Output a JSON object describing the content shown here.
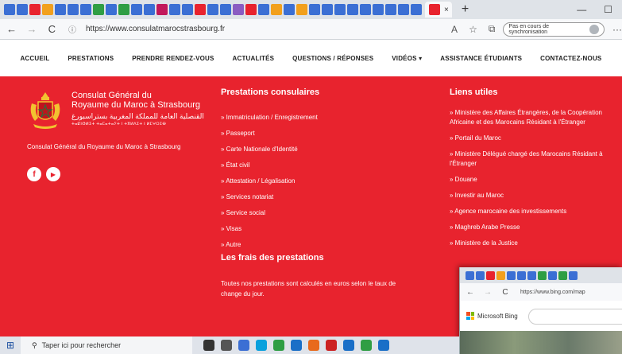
{
  "browser": {
    "tab_close": "×",
    "new_tab": "+",
    "window_controls": [
      "—",
      "☐"
    ],
    "back": "←",
    "forward": "→",
    "refresh": "C",
    "url": "https://www.consulatmarocstrasbourg.fr",
    "sync_status": "Pas en cours de synchronisation",
    "more": "···",
    "tab_icon_colors": [
      "#3b6fd4",
      "#3b6fd4",
      "#e8232e",
      "#f2a01d",
      "#3b6fd4",
      "#3b6fd4",
      "#3b6fd4",
      "#2f9e44",
      "#3b6fd4",
      "#2f9e44",
      "#3b6fd4",
      "#3b6fd4",
      "#c2185b",
      "#3b6fd4",
      "#3b6fd4",
      "#e8232e",
      "#3b6fd4",
      "#3b6fd4",
      "#8a5cc2",
      "#e8232e",
      "#3b6fd4",
      "#f2a01d",
      "#3b6fd4",
      "#f2a01d",
      "#3b6fd4",
      "#3b6fd4",
      "#3b6fd4",
      "#3b6fd4",
      "#3b6fd4",
      "#3b6fd4",
      "#3b6fd4",
      "#3b6fd4",
      "#3b6fd4"
    ]
  },
  "nav": {
    "items": [
      "ACCUEIL",
      "PRESTATIONS",
      "PRENDRE RENDEZ-VOUS",
      "ACTUALITÉS",
      "QUESTIONS / RÉPONSES",
      "VIDÉOS ▾",
      "ASSISTANCE ÉTUDIANTS",
      "CONTACTEZ-NOUS"
    ]
  },
  "footer": {
    "logo_line1": "Consulat Général du",
    "logo_line2": "Royaume du Maroc à Strasbourg",
    "logo_arabic": "القنصلية العامة للمملكة المغربية بستراسبورغ",
    "logo_small": "ⵜⴰⵇⵏⵚⵍⵉⵜ ⵜⴰⵎⴰⵜⴰⵢⵜ ⵏ ⵜⴳⵍⴷⵉⵜ ⵏ ⵍⵎⵖⵔⵉⴱ",
    "description": "Consulat Général du Royaume du Maroc à Strasbourg",
    "social_facebook": "f",
    "social_youtube": "▶",
    "prestations_title": "Prestations consulaires",
    "prestations": [
      "Immatriculation / Enregistrement",
      "Passeport",
      "Carte Nationale d'Identité",
      "État civil",
      "Attestation / Légalisation",
      "Services notariat",
      "Service social",
      "Visas",
      "Autre"
    ],
    "frais_title": "Les frais des prestations",
    "frais_text": "Toutes nos prestations sont calculés en euros selon le taux de change du jour.",
    "liens_title": "Liens utiles",
    "liens": [
      "Ministère des Affaires Étrangères, de la Coopération Africaine et des Marocains Résidant à l'Étranger",
      "Portail du Maroc",
      "Ministère Délégué chargé des Marocains Résidant à l'Étranger",
      "Douane",
      "Investir au Maroc",
      "Agence marocaine des investissements",
      "Maghreb Arabe Presse",
      "Ministère de la Justice"
    ]
  },
  "bing_window": {
    "url": "https://www.bing.com/map",
    "brand": "Microsoft Bing"
  },
  "taskbar": {
    "search_placeholder": "Taper ici pour rechercher",
    "app_colors": [
      "#333",
      "#555",
      "#3b6fd4",
      "#0aa1dd",
      "#2f9e44",
      "#1a6fc7",
      "#e86a1d",
      "#c22",
      "#1a6fc7",
      "#2f9e44",
      "#1a6fc7"
    ]
  }
}
